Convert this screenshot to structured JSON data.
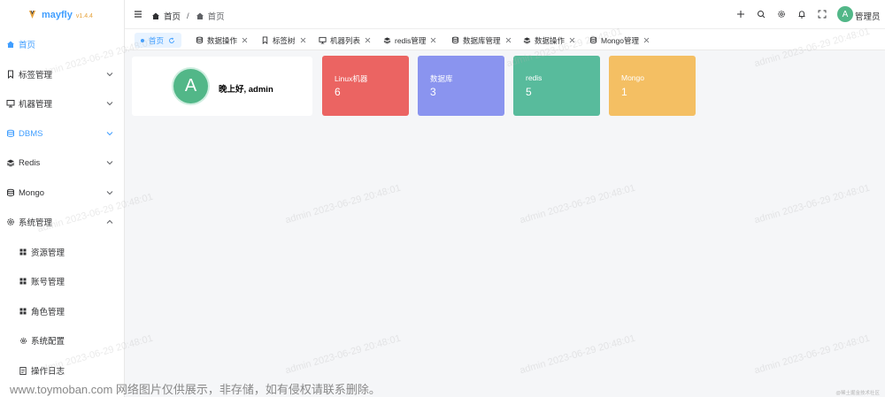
{
  "app": {
    "name": "mayfly",
    "version": "v1.4.4"
  },
  "sidebar": {
    "items": [
      {
        "label": "首页",
        "icon": "home-icon",
        "active": true
      },
      {
        "label": "标签管理",
        "icon": "bookmark-icon",
        "expand": "down"
      },
      {
        "label": "机器管理",
        "icon": "monitor-icon",
        "expand": "down"
      },
      {
        "label": "DBMS",
        "icon": "database-icon",
        "expand": "down",
        "active": true
      },
      {
        "label": "Redis",
        "icon": "layers-icon",
        "expand": "down"
      },
      {
        "label": "Mongo",
        "icon": "database-icon",
        "expand": "down"
      },
      {
        "label": "系统管理",
        "icon": "gear-icon",
        "expand": "up"
      }
    ],
    "subitems": [
      {
        "label": "资源管理",
        "icon": "grid-icon"
      },
      {
        "label": "账号管理",
        "icon": "grid-icon"
      },
      {
        "label": "角色管理",
        "icon": "grid-icon"
      },
      {
        "label": "系统配置",
        "icon": "gear-icon"
      },
      {
        "label": "操作日志",
        "icon": "document-icon"
      }
    ]
  },
  "header": {
    "breadcrumb": [
      "首页",
      "首页"
    ],
    "user": {
      "initial": "A",
      "name": "管理员"
    }
  },
  "tabs": [
    {
      "label": "首页",
      "active": true
    },
    {
      "label": "数据操作",
      "icon": "database-icon"
    },
    {
      "label": "标签树",
      "icon": "bookmark-icon"
    },
    {
      "label": "机器列表",
      "icon": "monitor-icon"
    },
    {
      "label": "redis管理",
      "icon": "layers-icon"
    },
    {
      "label": "数据库管理",
      "icon": "database-icon"
    },
    {
      "label": "数据操作",
      "icon": "layers-icon"
    },
    {
      "label": "Mongo管理",
      "icon": "database-icon"
    }
  ],
  "welcome": {
    "initial": "A",
    "greeting": "晚上好, admin"
  },
  "stats": [
    {
      "label": "Linux机器",
      "value": "6",
      "color": "#eb6462"
    },
    {
      "label": "数据库",
      "value": "3",
      "color": "#8a94ef"
    },
    {
      "label": "redis",
      "value": "5",
      "color": "#58bb9c"
    },
    {
      "label": "Mongo",
      "value": "1",
      "color": "#f4bf63"
    }
  ],
  "watermark_text": "admin 2023-06-29 20:48:01",
  "footer_note": "www.toymoban.com 网络图片仅供展示，非存储，如有侵权请联系删除。",
  "corner_note": "@稀土掘金技术社区"
}
